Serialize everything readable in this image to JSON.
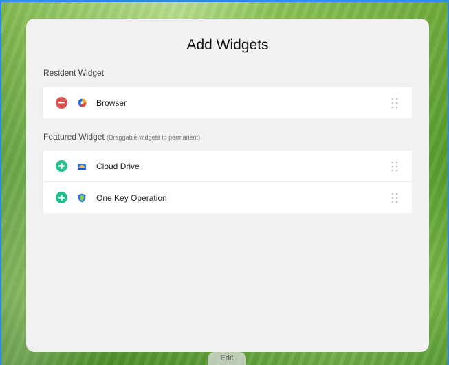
{
  "title": "Add Widgets",
  "resident": {
    "label": "Resident Widget",
    "items": [
      {
        "label": "Browser",
        "action": "remove",
        "icon": "browser-icon"
      }
    ]
  },
  "featured": {
    "label": "Featured Widget",
    "note": "(Draggable widgets to permanent)",
    "items": [
      {
        "label": "Cloud Drive",
        "action": "add",
        "icon": "cloud-drive-icon"
      },
      {
        "label": "One Key Operation",
        "action": "add",
        "icon": "shield-icon"
      }
    ]
  },
  "footer": {
    "edit_label": "Edit"
  },
  "colors": {
    "remove": "#d9534f",
    "add": "#1fc08a",
    "panel": "#f1f1f1"
  }
}
